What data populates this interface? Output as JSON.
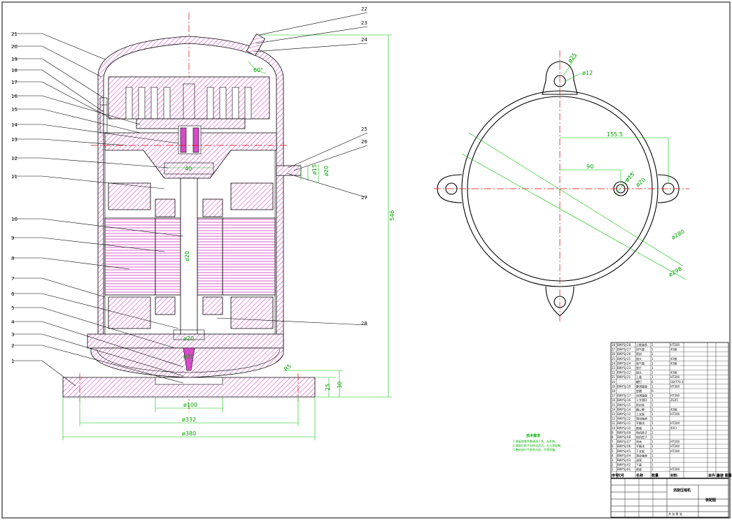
{
  "part_callouts": [
    "1",
    "2",
    "3",
    "4",
    "5",
    "6",
    "7",
    "8",
    "9",
    "10",
    "11",
    "12",
    "13",
    "14",
    "15",
    "16",
    "17",
    "18",
    "19",
    "20",
    "21",
    "22",
    "23",
    "24",
    "25",
    "26",
    "27",
    "28"
  ],
  "section_dims": {
    "height": "546",
    "angle": "60°",
    "pipe_d1": "ø15",
    "pipe_d2": "ø20",
    "base_h1": "25",
    "base_h2": "30",
    "chamfer": "R5",
    "d_inner": "ø100",
    "d_mid": "ø332",
    "d_outer": "ø380",
    "shaft_1": "40",
    "shaft_2": "ø20",
    "shaft_3": "ø20",
    "shaft_4": "ø30"
  },
  "plan_dims": {
    "lug_hole": "ø25",
    "lug_d": "ø12",
    "offset_long": "155.5",
    "offset_short": "90",
    "port_1": "ø15",
    "port_2": "ø20",
    "shell_inner": "ø280",
    "shell_outer": "ø298"
  },
  "tech_requirements": {
    "title": "技术要求",
    "lines": [
      "1.装配前零件需清洗干净，去毛刺。",
      "2.装配后转子应转动灵活，无卡滞现象。",
      "3.整机进行气密性试验，不得泄漏。"
    ]
  },
  "bom_rows": [
    {
      "no": "28",
      "code": "BWYSJ-28",
      "name": "止推轴承",
      "qty": "1",
      "mat": "HT200"
    },
    {
      "no": "27",
      "code": "BWYSJ-27",
      "name": "排气管",
      "qty": "1",
      "mat": "45钢"
    },
    {
      "no": "26",
      "code": "BWYSJ-26",
      "name": "密封",
      "qty": "2",
      "mat": ""
    },
    {
      "no": "25",
      "code": "BWYSJ-25",
      "name": "接头",
      "qty": "1",
      "mat": "45钢"
    },
    {
      "no": "24",
      "code": "BWYSJ-24",
      "name": "吸气管",
      "qty": "1",
      "mat": "45钢"
    },
    {
      "no": "23",
      "code": "BWYSJ-23",
      "name": "垫片",
      "qty": "1",
      "mat": ""
    },
    {
      "no": "22",
      "code": "BWYSJ-22",
      "name": "接头",
      "qty": "1",
      "mat": "45钢"
    },
    {
      "no": "21",
      "code": "BWYSJ-21",
      "name": "上盖",
      "qty": "1",
      "mat": "HT200"
    },
    {
      "no": "20",
      "code": "",
      "name": "螺钉",
      "qty": "6",
      "mat": "GB/T70.1"
    },
    {
      "no": "19",
      "code": "BWYSJ-19",
      "name": "静涡旋盘",
      "qty": "1",
      "mat": "HT300"
    },
    {
      "no": "18",
      "code": "",
      "name": "垫圈",
      "qty": "6",
      "mat": ""
    },
    {
      "no": "17",
      "code": "BWYSJ-17",
      "name": "动涡旋盘",
      "qty": "1",
      "mat": "HT300"
    },
    {
      "no": "16",
      "code": "BWYSJ-16",
      "name": "十字滑环",
      "qty": "1",
      "mat": "ZG45"
    },
    {
      "no": "15",
      "code": "BWYSJ-15",
      "name": "密封条",
      "qty": "1",
      "mat": ""
    },
    {
      "no": "14",
      "code": "BWYSJ-14",
      "name": "偏心套",
      "qty": "1",
      "mat": "45钢"
    },
    {
      "no": "13",
      "code": "BWYSJ-13",
      "name": "上支架",
      "qty": "1",
      "mat": "HT200"
    },
    {
      "no": "12",
      "code": "BWYSJ-12",
      "name": "滑动轴承",
      "qty": "1",
      "mat": ""
    },
    {
      "no": "11",
      "code": "BWYSJ-11",
      "name": "平衡块",
      "qty": "1",
      "mat": "HT200"
    },
    {
      "no": "10",
      "code": "BWYSJ-10",
      "name": "曲轴",
      "qty": "1",
      "mat": "40Cr"
    },
    {
      "no": "9",
      "code": "BWYSJ-09",
      "name": "电机转子",
      "qty": "1",
      "mat": ""
    },
    {
      "no": "8",
      "code": "BWYSJ-08",
      "name": "电机定子",
      "qty": "1",
      "mat": ""
    },
    {
      "no": "7",
      "code": "BWYSJ-07",
      "name": "壳体",
      "qty": "1",
      "mat": "HT200"
    },
    {
      "no": "6",
      "code": "BWYSJ-06",
      "name": "平衡块",
      "qty": "1",
      "mat": "HT200"
    },
    {
      "no": "5",
      "code": "BWYSJ-05",
      "name": "下支架",
      "qty": "1",
      "mat": "HT200"
    },
    {
      "no": "4",
      "code": "BWYSJ-04",
      "name": "滑动轴承",
      "qty": "1",
      "mat": ""
    },
    {
      "no": "3",
      "code": "BWYSJ-03",
      "name": "油泵",
      "qty": "1",
      "mat": ""
    },
    {
      "no": "2",
      "code": "BWYSJ-02",
      "name": "下盖",
      "qty": "1",
      "mat": ""
    },
    {
      "no": "1",
      "code": "BWYSJ-01",
      "name": "底座",
      "qty": "1",
      "mat": "HT200"
    }
  ],
  "bom_header": {
    "no": "序号",
    "code": "代号",
    "name": "名称",
    "qty": "数量",
    "mat": "材料",
    "weight": "单件 总计 重量",
    "note": "备注"
  },
  "title_block": {
    "drawing_name": "涡旋压缩机",
    "drawing_label": "装配图",
    "sheet": "共 张 第 张"
  },
  "colors": {
    "centerline": "#e00000",
    "dimension": "#00b000",
    "section_hatch": "#d64cc8"
  }
}
